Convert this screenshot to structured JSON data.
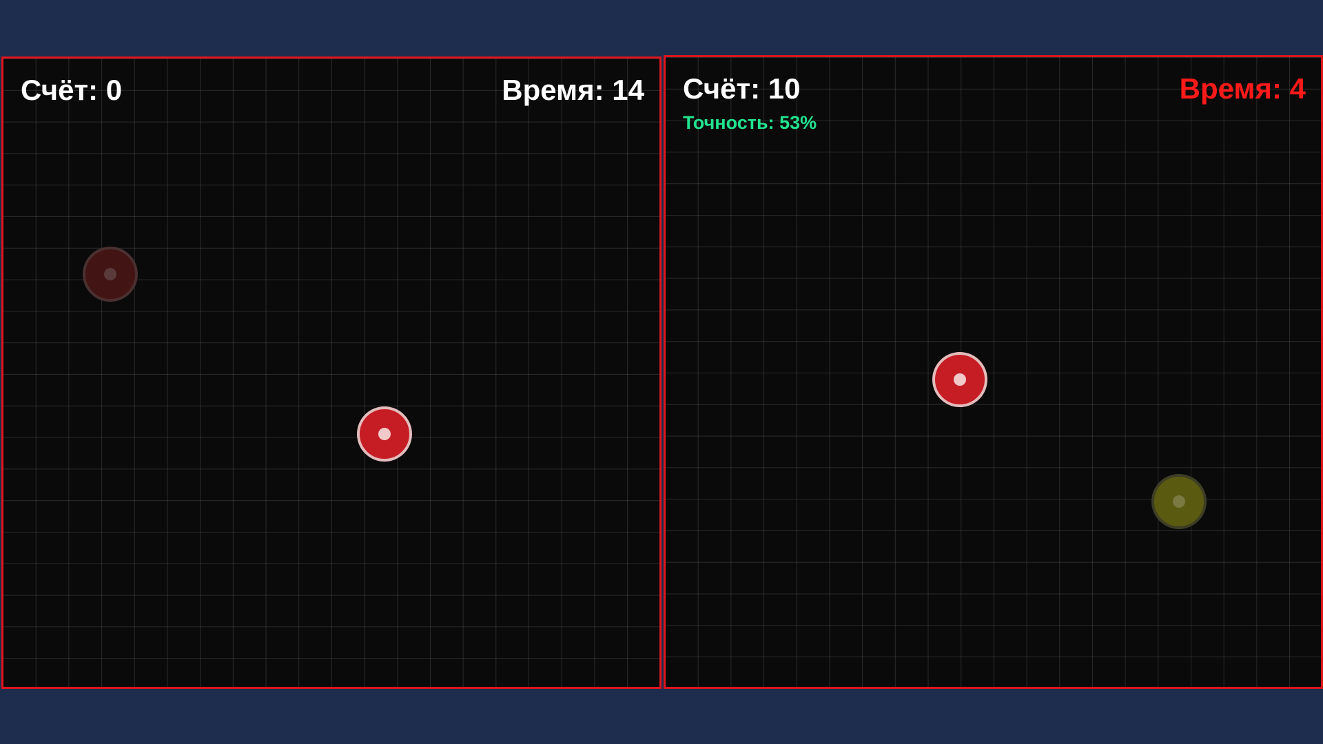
{
  "left_board": {
    "score_label": "Счёт: 0",
    "time_label": "Время: 14",
    "targets": [
      {
        "kind": "fading"
      },
      {
        "kind": "active"
      }
    ]
  },
  "right_board": {
    "score_label": "Счёт: 10",
    "time_label": "Время: 4",
    "time_color": "#ff1a1a",
    "accuracy_label": "Точность: 53%",
    "accuracy_color": "#22e38e",
    "targets": [
      {
        "kind": "active"
      },
      {
        "kind": "bonus"
      }
    ]
  },
  "colors": {
    "background": "#1e2d4d",
    "board_border": "#e0141c",
    "board_fill": "#0a0a0a",
    "target_red": "#c61d25",
    "target_bonus": "#5a5a10"
  }
}
